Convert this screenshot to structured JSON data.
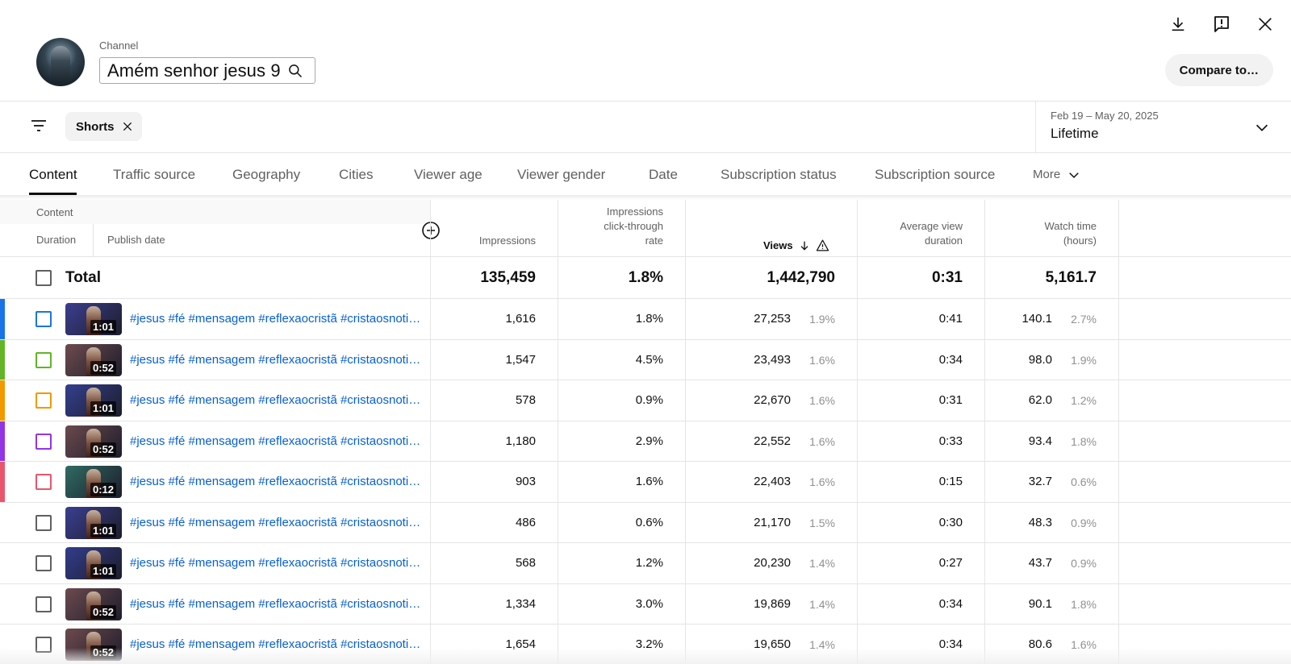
{
  "header": {
    "channel_label": "Channel",
    "channel_name": "Amém senhor jesus 9",
    "compare_label": "Compare to…"
  },
  "filter": {
    "chip_label": "Shorts",
    "date_range": "Feb 19 – May 20, 2025",
    "date_label": "Lifetime"
  },
  "tabs": [
    "Content",
    "Traffic source",
    "Geography",
    "Cities",
    "Viewer age",
    "Viewer gender",
    "Date",
    "Subscription status",
    "Subscription source",
    "More"
  ],
  "table": {
    "headers": {
      "content": "Content",
      "duration": "Duration",
      "publish_date": "Publish date",
      "impressions": "Impressions",
      "ctr_1": "Impressions",
      "ctr_2": "click-through",
      "ctr_3": "rate",
      "views": "Views",
      "avd_1": "Average view",
      "avd_2": "duration",
      "wt_1": "Watch time",
      "wt_2": "(hours)"
    },
    "total": {
      "label": "Total",
      "impressions": "135,459",
      "ctr": "1.8%",
      "views": "1,442,790",
      "avd": "0:31",
      "watch_time": "5,161.7"
    },
    "rows": [
      {
        "color": "#1a73e8",
        "duration": "1:01",
        "title": "#jesus #fé #mensagem #reflexaocristã #cristaosnotik…",
        "impressions": "1,616",
        "ctr": "1.8%",
        "views": "27,253",
        "views_pct": "1.9%",
        "avd": "0:41",
        "watch_time": "140.1",
        "wt_pct": "2.7%",
        "thumb": "#3b3f8f"
      },
      {
        "color": "#62b526",
        "duration": "0:52",
        "title": "#jesus #fé #mensagem #reflexaocristã #cristaosnotik…",
        "impressions": "1,547",
        "ctr": "4.5%",
        "views": "23,493",
        "views_pct": "1.6%",
        "avd": "0:34",
        "watch_time": "98.0",
        "wt_pct": "1.9%",
        "thumb": "#6e4b4f"
      },
      {
        "color": "#f29900",
        "duration": "1:01",
        "title": "#jesus #fé #mensagem #reflexaocristã #cristaosnotik…",
        "impressions": "578",
        "ctr": "0.9%",
        "views": "22,670",
        "views_pct": "1.6%",
        "avd": "0:31",
        "watch_time": "62.0",
        "wt_pct": "1.2%",
        "thumb": "#34408f"
      },
      {
        "color": "#9334e6",
        "duration": "0:52",
        "title": "#jesus #fé #mensagem #reflexaocristã #cristaosnotik…",
        "impressions": "1,180",
        "ctr": "2.9%",
        "views": "22,552",
        "views_pct": "1.6%",
        "avd": "0:33",
        "watch_time": "93.4",
        "wt_pct": "1.8%",
        "thumb": "#6b4a4e"
      },
      {
        "color": "#e8556d",
        "duration": "0:12",
        "title": "#jesus #fé #mensagem #reflexaocristã #cristaosnotik…",
        "impressions": "903",
        "ctr": "1.6%",
        "views": "22,403",
        "views_pct": "1.6%",
        "avd": "0:15",
        "watch_time": "32.7",
        "wt_pct": "0.6%",
        "thumb": "#2f6b63"
      },
      {
        "color": "",
        "duration": "1:01",
        "title": "#jesus #fé #mensagem #reflexaocristã #cristaosnotik…",
        "impressions": "486",
        "ctr": "0.6%",
        "views": "21,170",
        "views_pct": "1.5%",
        "avd": "0:30",
        "watch_time": "48.3",
        "wt_pct": "0.9%",
        "thumb": "#3a3f91"
      },
      {
        "color": "",
        "duration": "1:01",
        "title": "#jesus #fé #mensagem #reflexaocristã #cristaosnotik…",
        "impressions": "568",
        "ctr": "1.2%",
        "views": "20,230",
        "views_pct": "1.4%",
        "avd": "0:27",
        "watch_time": "43.7",
        "wt_pct": "0.9%",
        "thumb": "#323d8c"
      },
      {
        "color": "",
        "duration": "0:52",
        "title": "#jesus #fé #mensagem #reflexaocristã #cristaosnotik…",
        "impressions": "1,334",
        "ctr": "3.0%",
        "views": "19,869",
        "views_pct": "1.4%",
        "avd": "0:34",
        "watch_time": "90.1",
        "wt_pct": "1.8%",
        "thumb": "#6c4a4f"
      },
      {
        "color": "",
        "duration": "0:52",
        "title": "#jesus #fé #mensagem #reflexaocristã #cristaosnotik…",
        "impressions": "1,654",
        "ctr": "3.2%",
        "views": "19,650",
        "views_pct": "1.4%",
        "avd": "0:34",
        "watch_time": "80.6",
        "wt_pct": "1.6%",
        "thumb": "#6e4a4e"
      }
    ]
  },
  "icons": {
    "download": "download-icon",
    "feedback": "feedback-icon",
    "close": "close-icon",
    "search": "search-icon",
    "filter": "filter-icon",
    "chip_close": "close-icon",
    "date_dropdown": "chevron-down-icon",
    "more": "chevron-down-icon",
    "add_column": "add-circle-icon",
    "sort": "arrow-down-icon",
    "warning": "warning-icon"
  },
  "colors": {
    "link": "#065fd4",
    "unselected_checkbox": "#606060"
  }
}
